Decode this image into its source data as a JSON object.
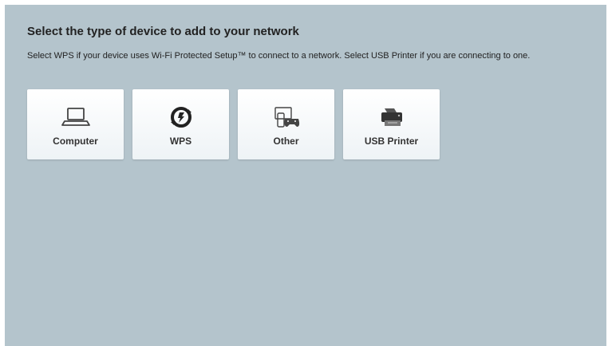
{
  "header": {
    "title": "Select the type of device to add to your network",
    "description": "Select WPS if your device uses Wi-Fi Protected Setup™ to connect to a network. Select USB Printer if you are connecting to one."
  },
  "devices": [
    {
      "label": "Computer",
      "icon": "laptop-icon"
    },
    {
      "label": "WPS",
      "icon": "wps-icon"
    },
    {
      "label": "Other",
      "icon": "tablet-gamepad-icon"
    },
    {
      "label": "USB Printer",
      "icon": "printer-icon"
    }
  ],
  "colors": {
    "panel_background": "#b4c4cc",
    "tile_background": "#ffffff",
    "text": "#222222"
  }
}
